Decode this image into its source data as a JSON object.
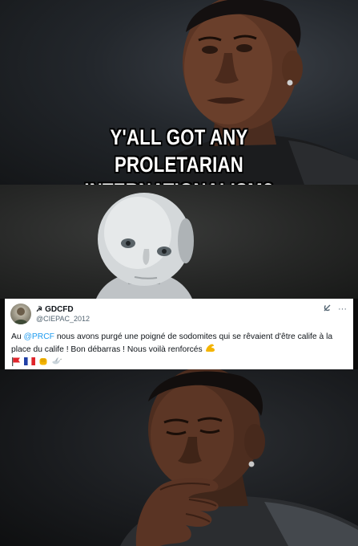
{
  "meme": {
    "caption_line1": "Y'ALL GOT ANY",
    "caption_line2": "PROLETARIAN INTERNATIONALISM?"
  },
  "tweet": {
    "display_name_symbol": "☭",
    "display_name": "GDCFD",
    "handle": "@CIEPAC_2012",
    "action_icons": [
      "grok-icon",
      "more-icon"
    ],
    "text_prefix": "Au ",
    "mention": "@PRCF",
    "text_main": " nous avons purgé une poigné de sodomites qui se rêvaient d'être calife à la place du calife ! Bon débarras !  Nous voilà renforcés ",
    "emojis": [
      "flexed-biceps-emoji",
      "red-flag-emoji",
      "france-flag-emoji",
      "fist-emoji",
      "dove-emoji"
    ]
  },
  "colors": {
    "caption_text": "#ffffff",
    "caption_outline": "#000000",
    "mention_blue": "#1d9bf0",
    "tweet_text": "#0f1419",
    "tweet_secondary": "#536471"
  }
}
